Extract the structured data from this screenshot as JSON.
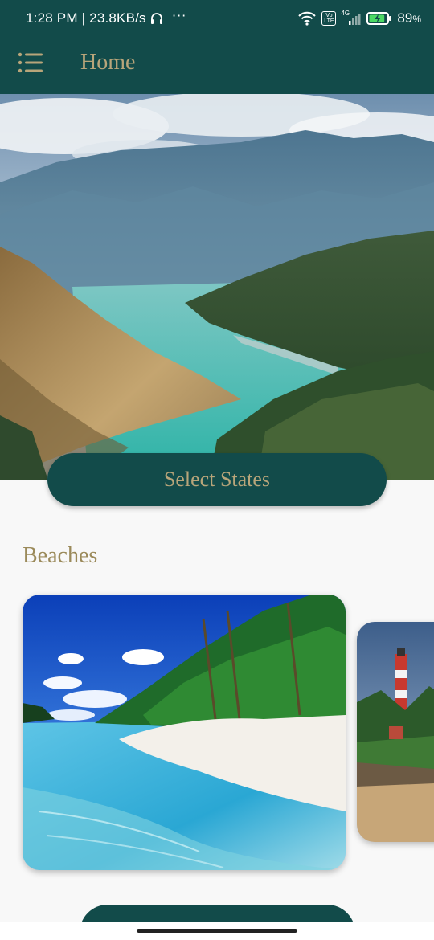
{
  "status_bar": {
    "time": "1:28 PM | 23.8KB/s",
    "more": "···",
    "network_label": "4G",
    "volte_label": "Vo LTE",
    "battery_percent": "89",
    "battery_unit": "%",
    "battery_level": 0.89,
    "icons": [
      "headphones-icon",
      "wifi-icon",
      "volte-icon",
      "signal-icon",
      "battery-charging-icon"
    ]
  },
  "app_bar": {
    "menu_icon": "list-menu-icon",
    "title": "Home"
  },
  "hero": {
    "image": "mountain-river-valley"
  },
  "select_states_button": {
    "label": "Select States"
  },
  "sections": [
    {
      "title": "Beaches",
      "cards": [
        {
          "image": "tropical-beach-palms"
        },
        {
          "image": "lighthouse-coast"
        }
      ]
    }
  ],
  "colors": {
    "primary": "#124b4a",
    "accent_gold": "#b8a57a",
    "section_title": "#9b8a5a",
    "background": "#f8f8f8"
  }
}
